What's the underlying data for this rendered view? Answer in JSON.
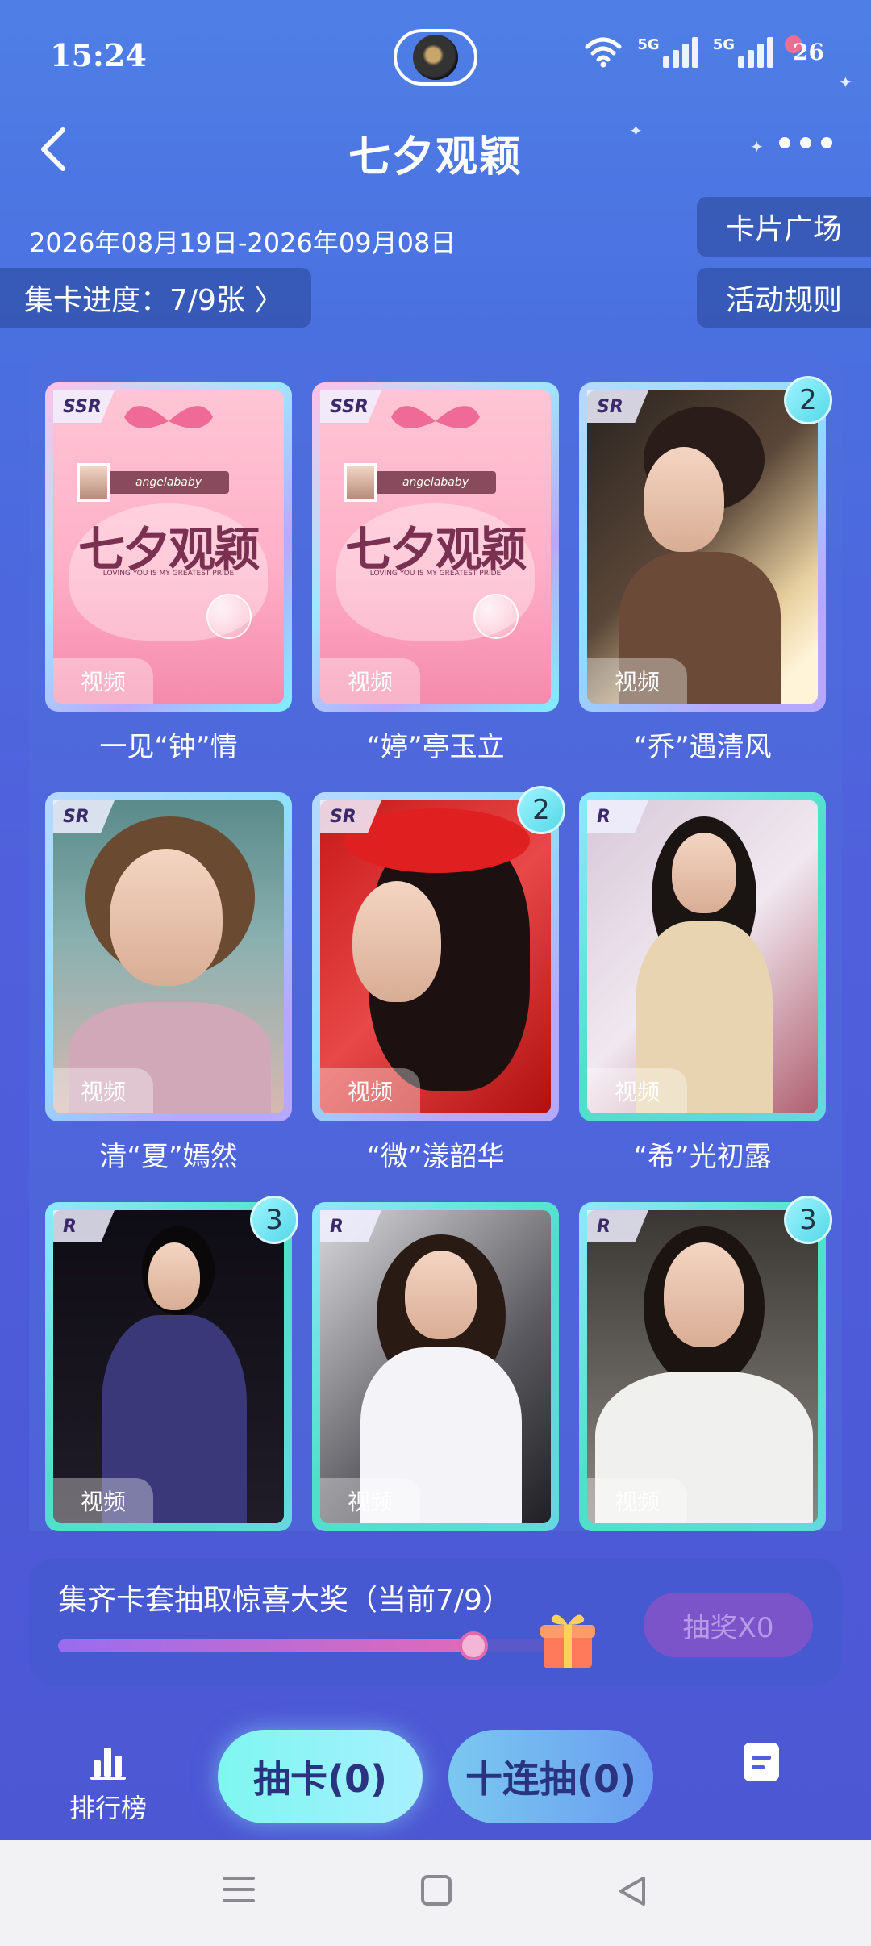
{
  "status_bar": {
    "time": "15:24",
    "signal1": "5G",
    "signal2": "5G",
    "battery": "26"
  },
  "header": {
    "title": "七夕观颖"
  },
  "event": {
    "date_range": "2026年08月19日-2026年09月08日",
    "card_plaza": "卡片广场",
    "progress": "集卡进度：7/9张 〉",
    "rules": "活动规则"
  },
  "cards": [
    {
      "name": "一见“钟”情",
      "rarity": "SSR",
      "tag": "视频",
      "count": "",
      "art": "poster"
    },
    {
      "name": "“婷”亭玉立",
      "rarity": "SSR",
      "tag": "视频",
      "count": "",
      "art": "poster"
    },
    {
      "name": "“乔”遇清风",
      "rarity": "SR",
      "tag": "视频",
      "count": "2",
      "art": "photo"
    },
    {
      "name": "清“夏”嫣然",
      "rarity": "SR",
      "tag": "视频",
      "count": "",
      "art": "photo"
    },
    {
      "name": "“微”漾韶华",
      "rarity": "SR",
      "tag": "视频",
      "count": "2",
      "art": "photo"
    },
    {
      "name": "“希”光初露",
      "rarity": "R",
      "tag": "视频",
      "count": "",
      "art": "photo"
    },
    {
      "name": "",
      "rarity": "R",
      "tag": "视频",
      "count": "3",
      "art": "photo"
    },
    {
      "name": "",
      "rarity": "R",
      "tag": "视频",
      "count": "",
      "art": "photo"
    },
    {
      "name": "",
      "rarity": "R",
      "tag": "视频",
      "count": "3",
      "art": "photo"
    }
  ],
  "poster": {
    "title": "七夕观颖",
    "banner": "angelababy",
    "subtitle": "LOVING YOU IS MY GREATEST PRIDE"
  },
  "prize": {
    "text": "集齐卡套抽取惊喜大奖（当前7/9）",
    "progress_fraction": 0.78,
    "lottery_button": "抽奖X0"
  },
  "bottom_nav": {
    "ranking": "排行榜",
    "draw": "抽卡(0)",
    "ten_draw": "十连抽(0)"
  }
}
